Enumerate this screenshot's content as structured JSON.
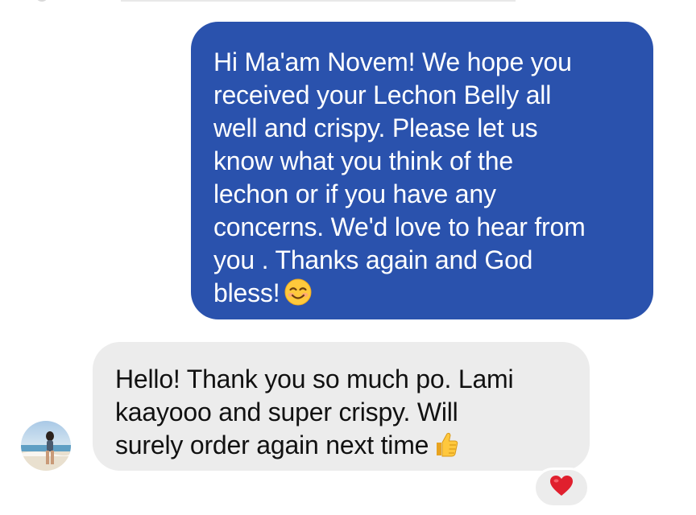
{
  "conversation": {
    "outgoing_message": {
      "lines": [
        "Hi Ma'am Novem! We hope you",
        "received your Lechon Belly all",
        "well and crispy. Please let us",
        "know what you think of the",
        "lechon or if you have any",
        "concerns. We'd love to hear from",
        "you . Thanks again and God",
        "bless!"
      ],
      "emoji": "smiling-face-icon"
    },
    "incoming_message": {
      "lines": [
        "Hello! Thank you so much po. Lami",
        "kaayooo and super crispy. Will",
        "surely order again next time"
      ],
      "emoji": "thumbs-up-icon"
    },
    "reaction": {
      "emoji": "red-heart-icon",
      "color": "#e0202e"
    },
    "colors": {
      "outgoing_bubble": "#2a52ad",
      "incoming_bubble": "#ececec"
    }
  }
}
